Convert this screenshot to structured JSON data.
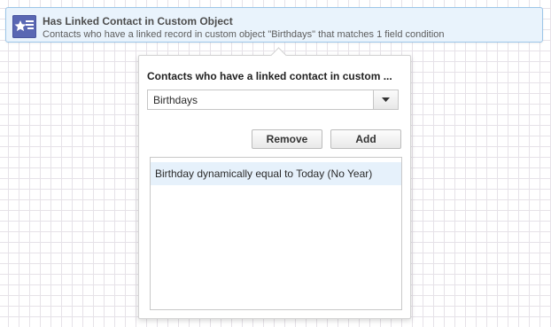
{
  "criterion": {
    "title": "Has Linked Contact in Custom Object",
    "description": "Contacts who have a linked record in custom object \"Birthdays\" that matches 1 field condition",
    "icon": "star-list-icon",
    "colors": {
      "card_background": "#e9f3fc",
      "card_border": "#9cc6e8",
      "icon_background": "#5967b3"
    }
  },
  "popover": {
    "title": "Contacts who have a linked contact in custom ...",
    "object_select": {
      "value": "Birthdays",
      "icon": "chevron-down-icon"
    },
    "buttons": {
      "remove_label": "Remove",
      "add_label": "Add"
    },
    "conditions": [
      {
        "label": "Birthday dynamically equal to Today (No Year)",
        "selected": true
      }
    ]
  }
}
